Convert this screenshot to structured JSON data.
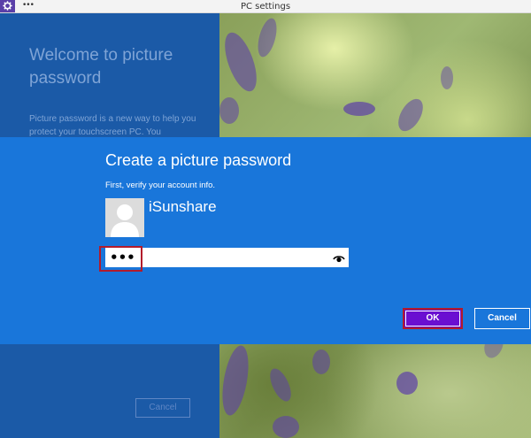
{
  "window": {
    "title": "PC settings",
    "menu_dots": "•••",
    "app_icon": "gear-icon"
  },
  "left_panel": {
    "title": "Welcome to picture password",
    "description": "Picture password is a new way to help you protect your touchscreen PC. You",
    "cancel_label": "Cancel"
  },
  "dialog": {
    "title": "Create a picture password",
    "subtitle": "First, verify your account info.",
    "user_name": "iSunshare",
    "avatar_icon": "user-avatar-icon",
    "password_value": "•••",
    "reveal_icon": "eye-icon",
    "ok_label": "OK",
    "cancel_label": "Cancel"
  },
  "colors": {
    "dialog_blue": "#1976da",
    "panel_blue": "#1b5aa7",
    "ok_purple": "#6a0fd1",
    "highlight_red": "#b21b2b"
  }
}
